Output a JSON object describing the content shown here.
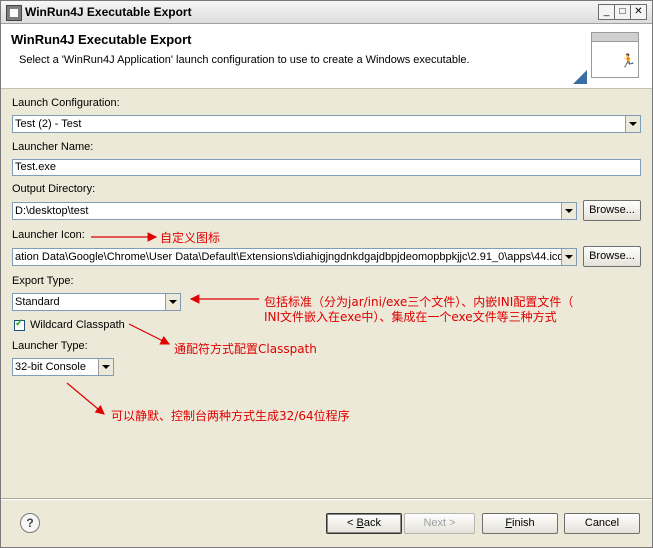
{
  "window": {
    "title": "WinRun4J Executable Export",
    "minimize": "_",
    "maximize": "□",
    "close": "✕"
  },
  "header": {
    "title": "WinRun4J Executable Export",
    "description": "Select a 'WinRun4J Application' launch configuration to use to create a Windows executable."
  },
  "form": {
    "launch_configuration": {
      "label": "Launch Configuration:",
      "value": "Test (2) - Test"
    },
    "launcher_name": {
      "label": "Launcher Name:",
      "value": "Test.exe"
    },
    "output_directory": {
      "label": "Output Directory:",
      "value": "D:\\desktop\\test",
      "browse": "Browse..."
    },
    "launcher_icon": {
      "label": "Launcher Icon:",
      "value": "ation Data\\Google\\Chrome\\User Data\\Default\\Extensions\\diahigjngdnkdgajdbpjdeomopbpkjjc\\2.91_0\\apps\\44.ico",
      "browse": "Browse..."
    },
    "export_type": {
      "label": "Export Type:",
      "value": "Standard"
    },
    "wildcard_classpath": {
      "label": "Wildcard Classpath",
      "checked": true
    },
    "launcher_type": {
      "label": "Launcher Type:",
      "value": "32-bit Console"
    }
  },
  "annotations": {
    "icon_note": "自定义图标",
    "export_note_line1": "包括标准（分为jar/ini/exe三个文件）、内嵌INI配置文件（",
    "export_note_line2": "INI文件嵌入在exe中）、集成在一个exe文件等三种方式",
    "classpath_note": "通配符方式配置Classpath",
    "launcher_note": "可以静默、控制台两种方式生成32/64位程序"
  },
  "buttons": {
    "back_prefix": "< ",
    "back_mnemonic": "B",
    "back_rest": "ack",
    "next": "Next >",
    "finish_mnemonic": "F",
    "finish_rest": "inish",
    "cancel": "Cancel",
    "help": "?"
  },
  "colors": {
    "annotation": "#e00000",
    "dialog_bg": "#ece9d8"
  }
}
